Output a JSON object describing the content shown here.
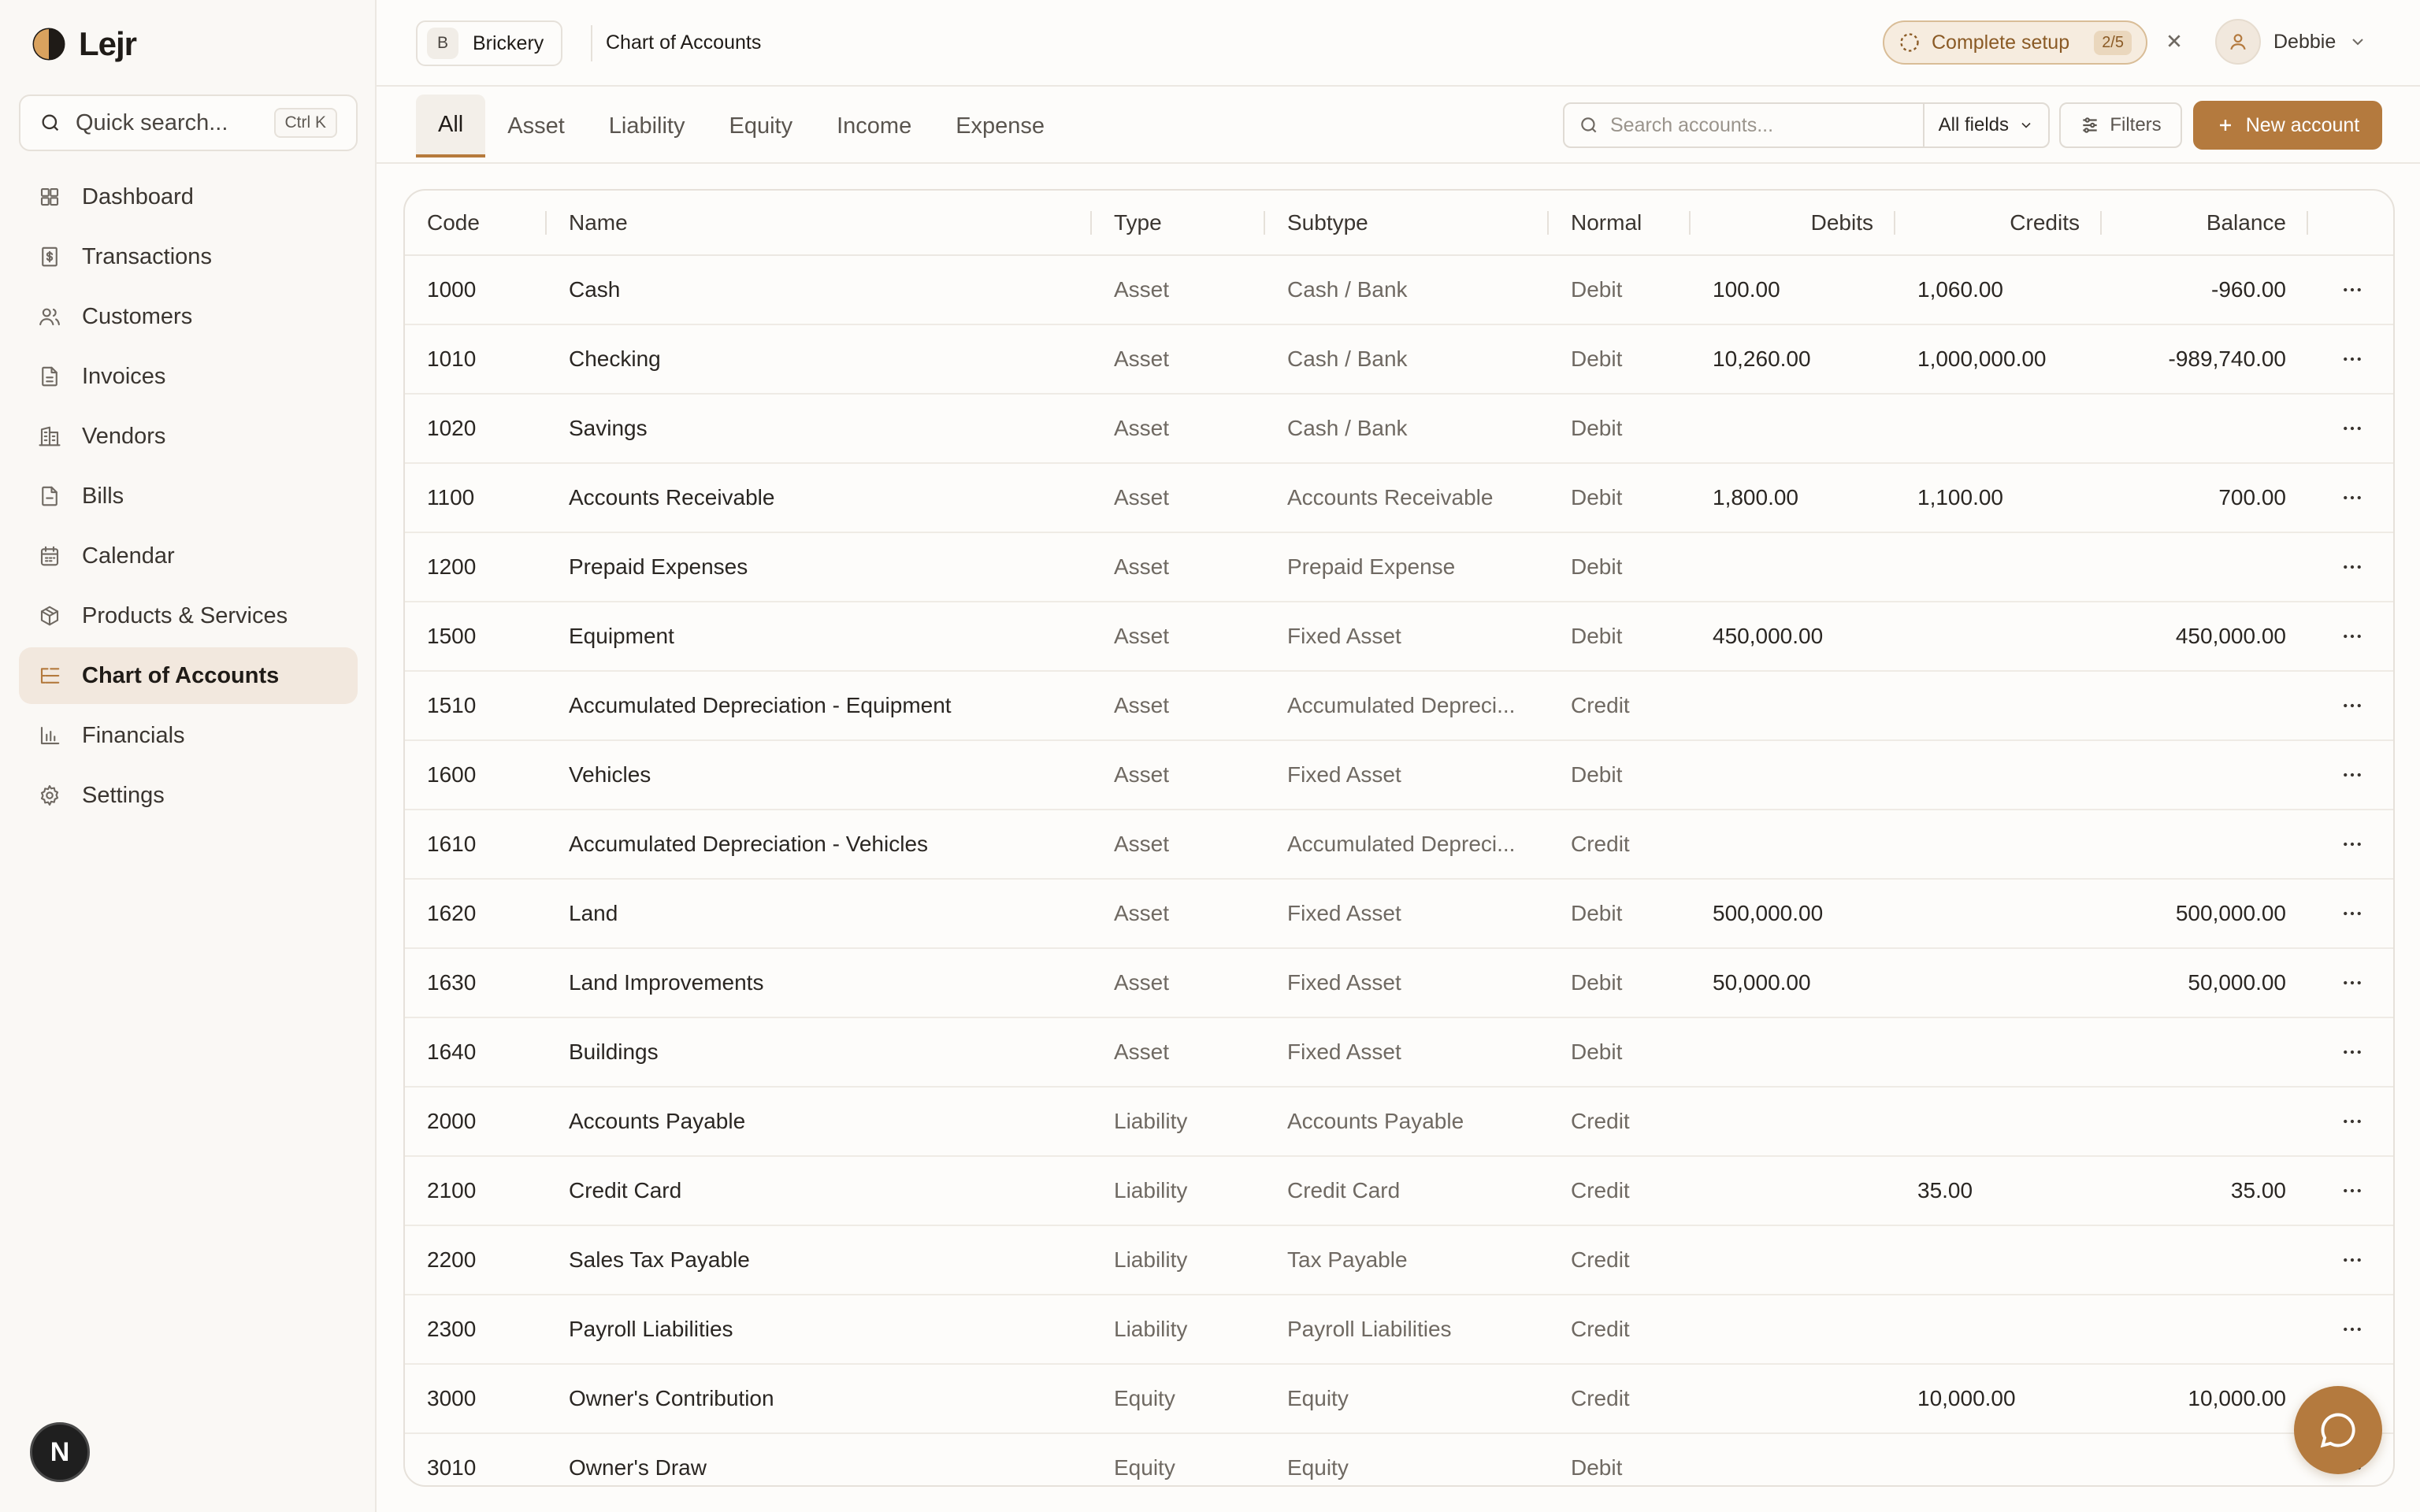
{
  "app": {
    "name": "Lejr"
  },
  "sidebar": {
    "search_label": "Quick search...",
    "search_shortcut": "Ctrl K",
    "items": [
      {
        "label": "Dashboard",
        "icon": "grid-icon"
      },
      {
        "label": "Transactions",
        "icon": "receipt-icon"
      },
      {
        "label": "Customers",
        "icon": "users-icon"
      },
      {
        "label": "Invoices",
        "icon": "document-icon"
      },
      {
        "label": "Vendors",
        "icon": "building-icon"
      },
      {
        "label": "Bills",
        "icon": "file-icon"
      },
      {
        "label": "Calendar",
        "icon": "calendar-icon"
      },
      {
        "label": "Products & Services",
        "icon": "package-icon"
      },
      {
        "label": "Chart of Accounts",
        "icon": "list-tree-icon",
        "active": true
      },
      {
        "label": "Financials",
        "icon": "bar-chart-icon"
      },
      {
        "label": "Settings",
        "icon": "gear-icon"
      }
    ],
    "footer_badge": "N"
  },
  "header": {
    "workspace_initial": "B",
    "workspace_name": "Brickery",
    "page_title": "Chart of Accounts",
    "setup_label": "Complete setup",
    "setup_progress": "2/5",
    "user_name": "Debbie"
  },
  "toolbar": {
    "tabs": [
      "All",
      "Asset",
      "Liability",
      "Equity",
      "Income",
      "Expense"
    ],
    "active_tab": "All",
    "search_placeholder": "Search accounts...",
    "field_select": "All fields",
    "filters_label": "Filters",
    "new_label": "New account"
  },
  "table": {
    "columns": [
      "Code",
      "Name",
      "Type",
      "Subtype",
      "Normal",
      "Debits",
      "Credits",
      "Balance"
    ],
    "rows": [
      {
        "code": "1000",
        "name": "Cash",
        "type": "Asset",
        "subtype": "Cash / Bank",
        "normal": "Debit",
        "debits": "100.00",
        "credits": "1,060.00",
        "balance": "-960.00"
      },
      {
        "code": "1010",
        "name": "Checking",
        "type": "Asset",
        "subtype": "Cash / Bank",
        "normal": "Debit",
        "debits": "10,260.00",
        "credits": "1,000,000.00",
        "balance": "-989,740.00"
      },
      {
        "code": "1020",
        "name": "Savings",
        "type": "Asset",
        "subtype": "Cash / Bank",
        "normal": "Debit",
        "debits": "",
        "credits": "",
        "balance": ""
      },
      {
        "code": "1100",
        "name": "Accounts Receivable",
        "type": "Asset",
        "subtype": "Accounts Receivable",
        "normal": "Debit",
        "debits": "1,800.00",
        "credits": "1,100.00",
        "balance": "700.00"
      },
      {
        "code": "1200",
        "name": "Prepaid Expenses",
        "type": "Asset",
        "subtype": "Prepaid Expense",
        "normal": "Debit",
        "debits": "",
        "credits": "",
        "balance": ""
      },
      {
        "code": "1500",
        "name": "Equipment",
        "type": "Asset",
        "subtype": "Fixed Asset",
        "normal": "Debit",
        "debits": "450,000.00",
        "credits": "",
        "balance": "450,000.00"
      },
      {
        "code": "1510",
        "name": "Accumulated Depreciation - Equipment",
        "type": "Asset",
        "subtype": "Accumulated Depreci...",
        "normal": "Credit",
        "debits": "",
        "credits": "",
        "balance": ""
      },
      {
        "code": "1600",
        "name": "Vehicles",
        "type": "Asset",
        "subtype": "Fixed Asset",
        "normal": "Debit",
        "debits": "",
        "credits": "",
        "balance": ""
      },
      {
        "code": "1610",
        "name": "Accumulated Depreciation - Vehicles",
        "type": "Asset",
        "subtype": "Accumulated Depreci...",
        "normal": "Credit",
        "debits": "",
        "credits": "",
        "balance": ""
      },
      {
        "code": "1620",
        "name": "Land",
        "type": "Asset",
        "subtype": "Fixed Asset",
        "normal": "Debit",
        "debits": "500,000.00",
        "credits": "",
        "balance": "500,000.00"
      },
      {
        "code": "1630",
        "name": "Land Improvements",
        "type": "Asset",
        "subtype": "Fixed Asset",
        "normal": "Debit",
        "debits": "50,000.00",
        "credits": "",
        "balance": "50,000.00"
      },
      {
        "code": "1640",
        "name": "Buildings",
        "type": "Asset",
        "subtype": "Fixed Asset",
        "normal": "Debit",
        "debits": "",
        "credits": "",
        "balance": ""
      },
      {
        "code": "2000",
        "name": "Accounts Payable",
        "type": "Liability",
        "subtype": "Accounts Payable",
        "normal": "Credit",
        "debits": "",
        "credits": "",
        "balance": ""
      },
      {
        "code": "2100",
        "name": "Credit Card",
        "type": "Liability",
        "subtype": "Credit Card",
        "normal": "Credit",
        "debits": "",
        "credits": "35.00",
        "balance": "35.00"
      },
      {
        "code": "2200",
        "name": "Sales Tax Payable",
        "type": "Liability",
        "subtype": "Tax Payable",
        "normal": "Credit",
        "debits": "",
        "credits": "",
        "balance": ""
      },
      {
        "code": "2300",
        "name": "Payroll Liabilities",
        "type": "Liability",
        "subtype": "Payroll Liabilities",
        "normal": "Credit",
        "debits": "",
        "credits": "",
        "balance": ""
      },
      {
        "code": "3000",
        "name": "Owner's Contribution",
        "type": "Equity",
        "subtype": "Equity",
        "normal": "Credit",
        "debits": "",
        "credits": "10,000.00",
        "balance": "10,000.00"
      },
      {
        "code": "3010",
        "name": "Owner's Draw",
        "type": "Equity",
        "subtype": "Equity",
        "normal": "Debit",
        "debits": "",
        "credits": "",
        "balance": ""
      }
    ]
  },
  "colors": {
    "accent": "#b47a3e",
    "active_nav_bg": "#f2e8de",
    "setup_bg": "#f6ecdf"
  }
}
